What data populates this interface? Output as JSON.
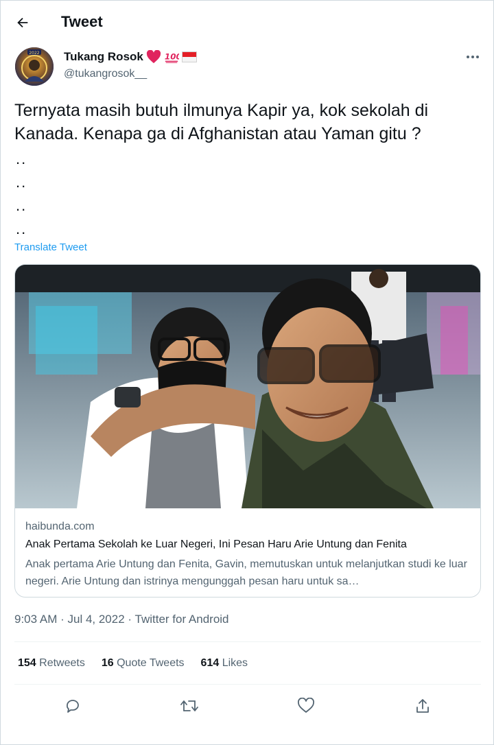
{
  "header": {
    "title": "Tweet",
    "back_icon": "arrow-left-icon"
  },
  "author": {
    "display_name": "Tukang Rosok",
    "name_emojis": [
      "heart-icon",
      "hundred-points-icon",
      "indonesia-flag-icon"
    ],
    "avatar_caption": "2022",
    "handle": "@tukangrosok__"
  },
  "tweet": {
    "text": "Ternyata masih butuh ilmunya Kapir ya, kok sekolah di Kanada. Kenapa ga di Afghanistan atau Yaman gitu ?",
    "dots": [
      "..",
      "..",
      "..",
      ".."
    ],
    "translate_label": "Translate Tweet"
  },
  "card": {
    "domain": "haibunda.com",
    "title": "Anak Pertama Sekolah ke Luar Negeri, Ini Pesan Haru Arie Untung dan Fenita",
    "description": "Anak pertama Arie Untung dan Fenita, Gavin, memutuskan untuk melanjutkan studi ke luar negeri. Arie Untung dan istrinya mengunggah pesan haru untuk sa…"
  },
  "meta": {
    "time": "9:03 AM",
    "date": "Jul 4, 2022",
    "source": "Twitter for Android"
  },
  "stats": {
    "retweets": {
      "count": "154",
      "label": "Retweets"
    },
    "quotes": {
      "count": "16",
      "label": "Quote Tweets"
    },
    "likes": {
      "count": "614",
      "label": "Likes"
    }
  },
  "actions": [
    "reply-icon",
    "retweet-icon",
    "like-icon",
    "share-icon"
  ],
  "colors": {
    "accent": "#1d9bf0",
    "text": "#0f1419",
    "secondary": "#536471",
    "border": "#cfd9de"
  }
}
